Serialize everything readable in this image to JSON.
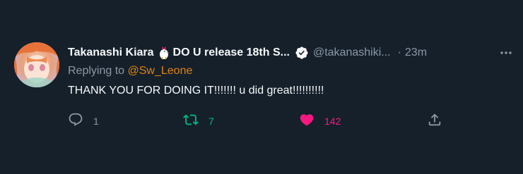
{
  "tweet": {
    "display_name": "Takanashi Kiara",
    "name_suffix": "DO U release 18th S...",
    "name_emoji": "chicken-emoji",
    "verified_icon": "verified-badge-icon",
    "handle": "@takanashiki...",
    "separator": "·",
    "time": "23m",
    "reply_prefix": "Replying to",
    "reply_to": "@Sw_Leone",
    "text": "THANK YOU FOR DOING IT!!!!!!! u did great!!!!!!!!!!"
  },
  "actions": {
    "reply": {
      "icon": "reply-icon",
      "count": "1"
    },
    "retweet": {
      "icon": "retweet-icon",
      "count": "7",
      "active": true
    },
    "like": {
      "icon": "heart-icon",
      "count": "142",
      "active": true
    },
    "share": {
      "icon": "share-icon"
    }
  },
  "colors": {
    "background": "#15202b",
    "primary_text": "#f7f9f9",
    "secondary_text": "#8b98a5",
    "mention": "#e4830b",
    "retweet_active": "#00ba7c",
    "like_active": "#f91880"
  }
}
